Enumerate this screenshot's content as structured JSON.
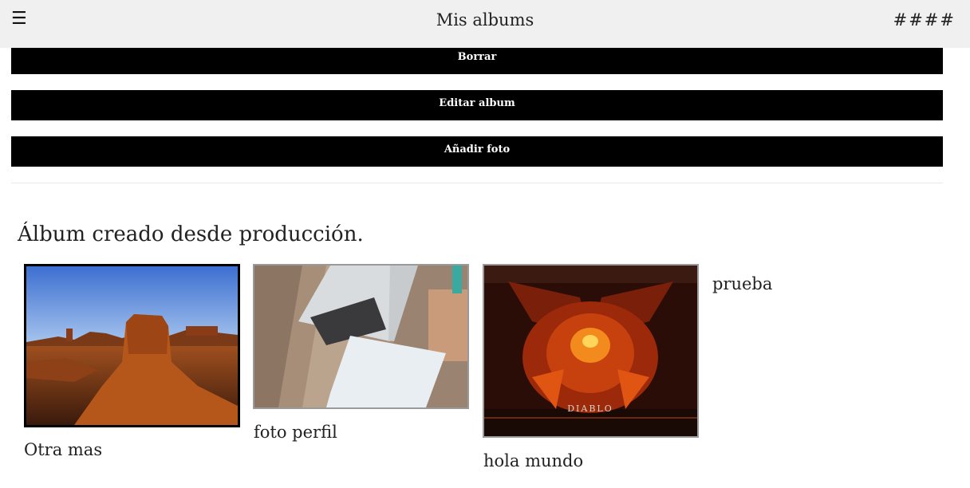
{
  "header": {
    "menu_icon": "☰",
    "title": "Mis albums",
    "right_text": "####"
  },
  "actions": {
    "delete_label": "Borrar",
    "edit_label": "Editar album",
    "add_photo_label": "Añadir foto"
  },
  "album": {
    "title": "Álbum creado desde producción.",
    "photos": [
      {
        "label": "Otra mas",
        "image": "desert-mesa-landscape"
      },
      {
        "label": "foto perfil",
        "image": "laptop-on-desk"
      },
      {
        "label": "hola mundo",
        "image": "diablo-demon-art"
      },
      {
        "label": "prueba"
      }
    ]
  },
  "colors": {
    "header_bg": "#f0f0f0",
    "button_bg": "#000000",
    "button_text": "#ffffff"
  }
}
